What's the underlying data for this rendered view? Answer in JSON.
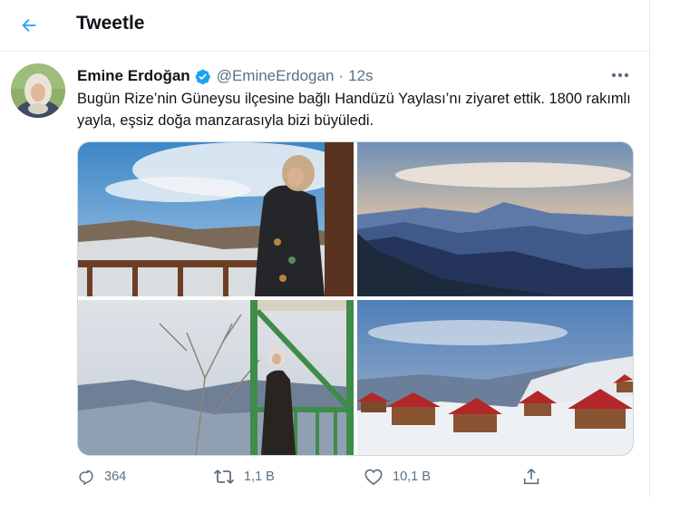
{
  "header": {
    "title": "Tweetle",
    "back_icon": "arrow-left-icon",
    "accent": "#1da1f2"
  },
  "tweet": {
    "author_name": "Emine Erdoğan",
    "handle": "@EmineErdogan",
    "separator": "·",
    "time": "12s",
    "verified_icon": "verified-badge-icon",
    "text": "Bugün Rize’nin Güneysu ilçesine bağlı Handüzü Yaylası’nı ziyaret ettik. 1800 rakımlı yayla, eşsiz doğa manzarasıyla bizi büyüledi."
  },
  "media": {
    "photos": [
      "woman-on-balcony-photo",
      "mountain-landscape-photo",
      "woman-in-tower-photo",
      "wooden-houses-snow-photo"
    ]
  },
  "actions": {
    "reply_count": "364",
    "retweet_count": "1,1 B",
    "like_count": "10,1 B",
    "icons": [
      "reply-icon",
      "retweet-icon",
      "like-icon",
      "share-icon"
    ]
  }
}
